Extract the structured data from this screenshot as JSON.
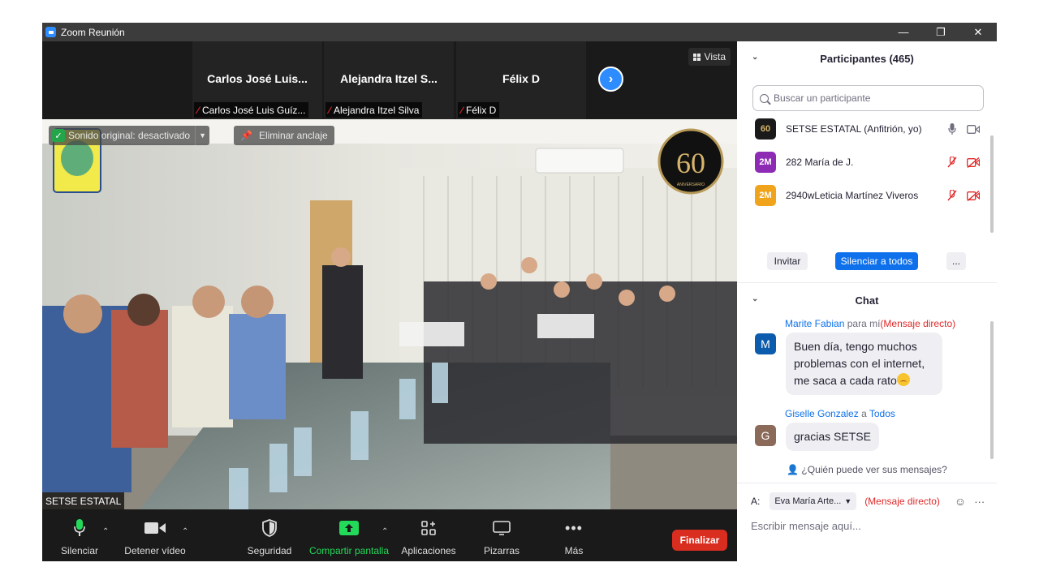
{
  "window": {
    "title": "Zoom Reunión",
    "controls": {
      "minimize": "—",
      "restore": "❐",
      "close": "✕"
    }
  },
  "strip": {
    "tiles": [
      {
        "name": "Carlos José Luis...",
        "label": "Carlos José Luis Guíz..."
      },
      {
        "name": "Alejandra  Itzel S...",
        "label": "Alejandra Itzel Silva"
      },
      {
        "name": "Félix D",
        "label": "Félix D"
      }
    ],
    "view_label": "Vista"
  },
  "main_video": {
    "original_sound": "Sonido original: desactivado",
    "unpin": "Eliminar anclaje",
    "speaker_name": "SETSE ESTATAL",
    "badge": "60",
    "badge_sub": "ANIVERSARIO"
  },
  "toolbar": {
    "mute": "Silenciar",
    "stop_video": "Detener vídeo",
    "security": "Seguridad",
    "share": "Compartir pantalla",
    "apps": "Aplicaciones",
    "whiteboards": "Pizarras",
    "more": "Más",
    "end": "Finalizar"
  },
  "participants": {
    "header": "Participantes (465)",
    "search_placeholder": "Buscar un participante",
    "list": [
      {
        "avatar": "60",
        "avatar_color": "#1a1a1a",
        "name": "SETSE ESTATAL (Anfitrión, yo)",
        "muted": false
      },
      {
        "avatar": "2M",
        "avatar_color": "#8e2bb5",
        "name": "282 María de J.",
        "muted": true
      },
      {
        "avatar": "2M",
        "avatar_color": "#f0a41b",
        "name": "2940wLeticia Martínez Viveros",
        "muted": true
      }
    ],
    "invite": "Invitar",
    "mute_all": "Silenciar a todos",
    "more": "..."
  },
  "chat": {
    "header": "Chat",
    "messages": [
      {
        "avatar": "M",
        "avatar_color": "#0b5cad",
        "sender": "Marite Fabian",
        "connector": "para mí",
        "target": "(Mensaje directo)",
        "lines": [
          "Buen día, tengo muchos",
          "problemas con el internet,",
          "me saca a cada rato"
        ]
      },
      {
        "avatar": "G",
        "avatar_color": "#8c6a5a",
        "sender": "Giselle Gonzalez",
        "connector": "a",
        "target": "Todos",
        "lines": [
          "gracias SETSE"
        ]
      }
    ],
    "who_can_see": "¿Quién puede ver sus mensajes?",
    "to_label": "A:",
    "to_value": "Eva María Arte...",
    "to_mode": "(Mensaje directo)",
    "compose_placeholder": "Escribir mensaje aquí..."
  },
  "colors": {
    "accent": "#0e71eb",
    "end": "#d92d20",
    "share": "#23d959"
  }
}
